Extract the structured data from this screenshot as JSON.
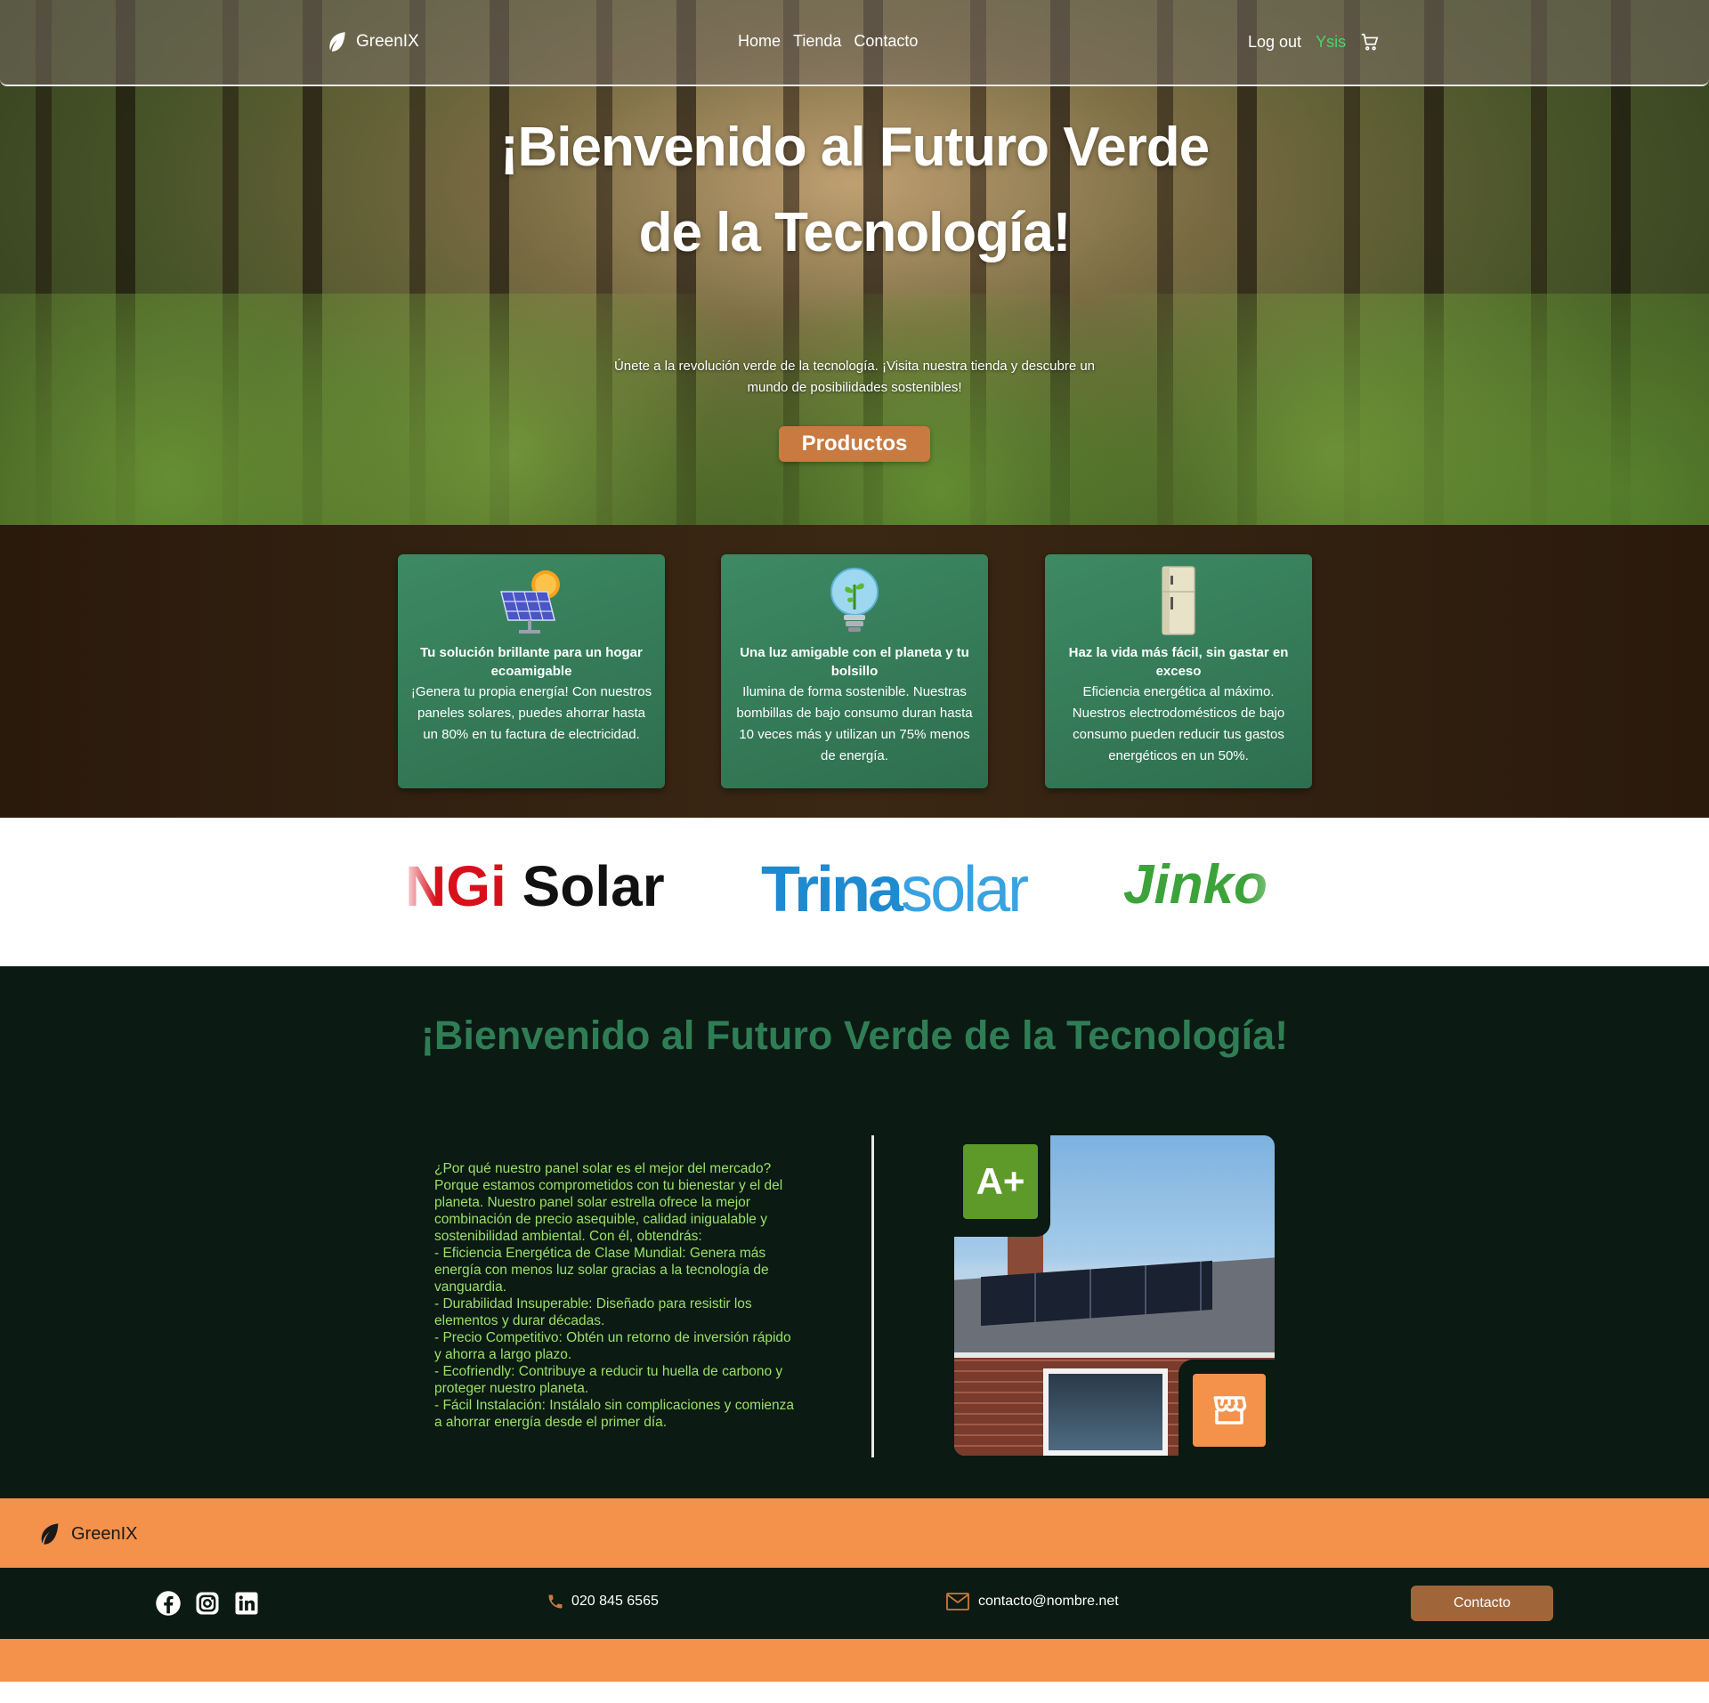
{
  "nav": {
    "brand": "GreenIX",
    "links": [
      "Home",
      "Tienda",
      "Contacto"
    ],
    "logout": "Log out",
    "user": "Ysis",
    "cart_icon": "cart-icon"
  },
  "hero": {
    "title": "¡Bienvenido al Futuro Verde de la Tecnología!",
    "subtitle": "Únete a la revolución verde de la tecnología. ¡Visita nuestra tienda y descubre un mundo de posibilidades sostenibles!",
    "cta": "Productos"
  },
  "features": [
    {
      "icon": "solar-panel-icon",
      "heading": "Tu solución brillante para un hogar ecoamigable",
      "body": "¡Genera tu propia energía! Con nuestros paneles solares, puedes ahorrar hasta un 80% en tu factura de electricidad."
    },
    {
      "icon": "eco-bulb-icon",
      "heading": "Una luz amigable con el planeta y tu bolsillo",
      "body": "Ilumina de forma sostenible. Nuestras bombillas de bajo consumo duran hasta 10 veces más y utilizan un 75% menos de energía."
    },
    {
      "icon": "fridge-icon",
      "heading": "Haz la vida más fácil, sin gastar en exceso",
      "body": "Eficiencia energética al máximo. Nuestros electrodomésticos de bajo consumo pueden reducir tus gastos energéticos en un 50%."
    }
  ],
  "brands": {
    "longi": {
      "main": "NGi",
      "suffix": " Solar"
    },
    "trina": {
      "main": "Trina",
      "suffix": "solar"
    },
    "jinko": {
      "main": "Jinko"
    }
  },
  "about": {
    "title": "¡Bienvenido al Futuro Verde de la Tecnología!",
    "text": "¿Por qué nuestro panel solar es el mejor del mercado? Porque estamos comprometidos con tu bienestar y el del planeta. Nuestro panel solar estrella ofrece la mejor combinación de precio asequible, calidad inigualable y sostenibilidad ambiental. Con él, obtendrás:\n- Eficiencia Energética de Clase Mundial: Genera más energía con menos luz solar gracias a la tecnología de vanguardia.\n- Durabilidad Insuperable: Diseñado para resistir los elementos y durar décadas.\n- Precio Competitivo: Obtén un retorno de inversión rápido y ahorra a largo plazo.\n- Ecofriendly: Contribuye a reducir tu huella de carbono y proteger nuestro planeta.\n- Fácil Instalación: Instálalo sin complicaciones y comienza a ahorrar energía desde el primer día.",
    "badge": "A+",
    "shop_icon": "store-icon"
  },
  "footer": {
    "brand": "GreenIX",
    "phone": "020 845 6565",
    "email": "contacto@nombre.net",
    "contact_button": "Contacto",
    "social_icons": [
      "facebook-icon",
      "instagram-icon",
      "linkedin-icon"
    ]
  },
  "colors": {
    "accent_orange": "#f4914a",
    "dark_green": "#0b1a12",
    "card_green": "#3d8a64",
    "user_green": "#4cd36a"
  }
}
